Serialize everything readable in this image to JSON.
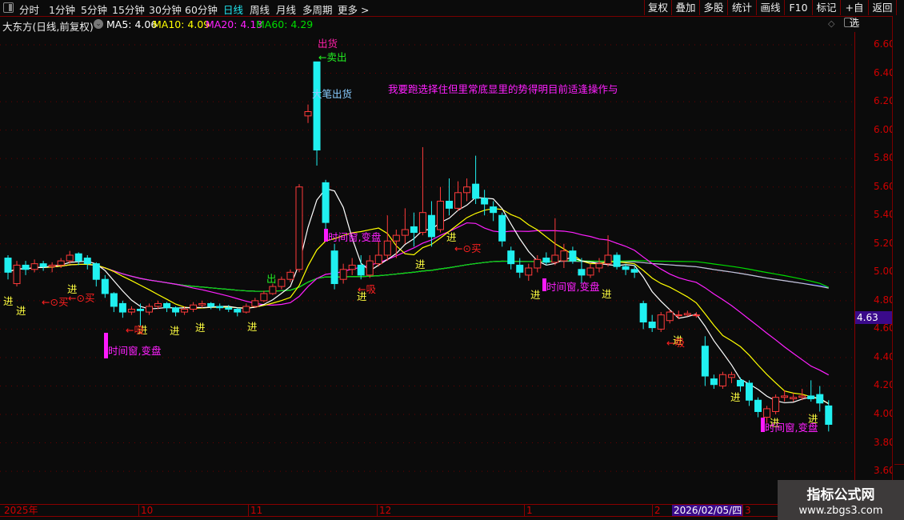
{
  "toolbar": {
    "periods": [
      "分时",
      "1分钟",
      "5分钟",
      "15分钟",
      "30分钟",
      "60分钟",
      "日线",
      "周线",
      "月线",
      "多周期",
      "更多 >"
    ],
    "active_period": "日线",
    "buttons": [
      "复权",
      "叠加",
      "多股",
      "统计",
      "画线",
      "F10",
      "标记",
      "+自选",
      "返回"
    ]
  },
  "title": {
    "stock": "大东方(日线,前复权)",
    "ma5": "MA5: 4.06",
    "ma10": "MA10: 4.09",
    "ma20": "MA20: 4.13",
    "ma60": "MA60: 4.29"
  },
  "colors": {
    "up": "#ff3b3b",
    "down": "#20f0f0",
    "ma5": "#ffffff",
    "ma10": "#ffff00",
    "ma20": "#ff20ff",
    "ma60": "#00dd00",
    "line5": "#c8c8c8",
    "line6": "#2020ff",
    "axis": "#d00000",
    "buy": "#ff2020",
    "enter": "#ffff40",
    "window": "#ff20ff"
  },
  "y_axis": {
    "ticks": [
      "6.60",
      "6.40",
      "6.20",
      "6.00",
      "5.80",
      "5.60",
      "5.40",
      "5.20",
      "5.00",
      "4.80",
      "4.60",
      "4.40",
      "4.20",
      "4.00",
      "3.80",
      "3.60"
    ],
    "current_price": "4.63"
  },
  "x_axis": {
    "labels": [
      "2025年",
      "10",
      "11",
      "12",
      "1",
      "2",
      "3"
    ],
    "selected_date": "2026/02/05/四"
  },
  "annotations": {
    "sell_top": "出货",
    "sell_arrow": "←卖出",
    "big_sell": "大笔出货",
    "message": "我要跑选择住但里常底显里的势得明目前适逢操作与",
    "enter": "进",
    "buy": "←⊙买",
    "absorb": "←吸",
    "out": "出",
    "window": "时间窗,变盘"
  },
  "watermark": {
    "title": "指标公式网",
    "url": "www.zbgs3.com"
  },
  "chart_data": {
    "type": "candlestick",
    "ylim": [
      3.5,
      6.7
    ],
    "ohlc": [
      [
        5.1,
        5.12,
        4.95,
        5.0
      ],
      [
        4.92,
        5.08,
        4.9,
        5.05
      ],
      [
        5.05,
        5.08,
        4.98,
        5.02
      ],
      [
        5.02,
        5.09,
        5.0,
        5.06
      ],
      [
        5.06,
        5.08,
        5.01,
        5.04
      ],
      [
        5.04,
        5.07,
        5.0,
        5.05
      ],
      [
        5.05,
        5.1,
        5.03,
        5.08
      ],
      [
        5.08,
        5.15,
        5.06,
        5.12
      ],
      [
        5.13,
        5.14,
        5.05,
        5.08
      ],
      [
        5.1,
        5.12,
        5.02,
        5.06
      ],
      [
        5.06,
        5.07,
        4.9,
        4.95
      ],
      [
        4.95,
        4.98,
        4.82,
        4.85
      ],
      [
        4.85,
        4.86,
        4.72,
        4.76
      ],
      [
        4.78,
        4.8,
        4.68,
        4.72
      ],
      [
        4.72,
        4.76,
        4.7,
        4.74
      ],
      [
        4.74,
        4.78,
        4.62,
        4.73
      ],
      [
        4.72,
        4.78,
        4.7,
        4.76
      ],
      [
        4.76,
        4.8,
        4.74,
        4.78
      ],
      [
        4.78,
        4.79,
        4.72,
        4.75
      ],
      [
        4.75,
        4.76,
        4.69,
        4.72
      ],
      [
        4.72,
        4.76,
        4.7,
        4.74
      ],
      [
        4.74,
        4.79,
        4.72,
        4.77
      ],
      [
        4.77,
        4.8,
        4.75,
        4.78
      ],
      [
        4.78,
        4.79,
        4.74,
        4.76
      ],
      [
        4.76,
        4.78,
        4.73,
        4.75
      ],
      [
        4.75,
        4.77,
        4.72,
        4.74
      ],
      [
        4.74,
        4.75,
        4.69,
        4.72
      ],
      [
        4.72,
        4.78,
        4.71,
        4.76
      ],
      [
        4.76,
        4.82,
        4.75,
        4.8
      ],
      [
        4.8,
        4.87,
        4.79,
        4.85
      ],
      [
        4.85,
        4.92,
        4.84,
        4.9
      ],
      [
        4.9,
        4.97,
        4.88,
        4.95
      ],
      [
        4.95,
        5.02,
        4.93,
        5.0
      ],
      [
        5.02,
        5.62,
        5.0,
        5.6
      ],
      [
        6.1,
        6.18,
        6.05,
        6.13
      ],
      [
        6.48,
        6.48,
        5.75,
        5.86
      ],
      [
        5.63,
        5.65,
        5.3,
        5.35
      ],
      [
        5.15,
        5.2,
        4.88,
        4.92
      ],
      [
        4.95,
        5.06,
        4.92,
        5.02
      ],
      [
        5.02,
        5.1,
        4.98,
        5.05
      ],
      [
        5.05,
        5.12,
        4.95,
        4.98
      ],
      [
        4.98,
        5.12,
        4.96,
        5.08
      ],
      [
        5.06,
        5.22,
        5.04,
        5.12
      ],
      [
        5.12,
        5.4,
        5.08,
        5.22
      ],
      [
        5.22,
        5.3,
        5.1,
        5.26
      ],
      [
        5.26,
        5.45,
        5.2,
        5.3
      ],
      [
        5.32,
        5.42,
        5.18,
        5.28
      ],
      [
        5.28,
        5.88,
        5.26,
        5.42
      ],
      [
        5.4,
        5.5,
        5.18,
        5.25
      ],
      [
        5.3,
        5.6,
        5.28,
        5.5
      ],
      [
        5.5,
        5.66,
        5.4,
        5.45
      ],
      [
        5.45,
        5.64,
        5.43,
        5.56
      ],
      [
        5.56,
        5.66,
        5.5,
        5.6
      ],
      [
        5.62,
        5.82,
        5.48,
        5.52
      ],
      [
        5.52,
        5.58,
        5.4,
        5.48
      ],
      [
        5.46,
        5.5,
        5.36,
        5.42
      ],
      [
        5.4,
        5.42,
        5.18,
        5.22
      ],
      [
        5.15,
        5.18,
        5.02,
        5.06
      ],
      [
        5.05,
        5.1,
        4.96,
        5.0
      ],
      [
        4.98,
        5.06,
        4.94,
        5.03
      ],
      [
        5.03,
        5.12,
        5.0,
        5.09
      ],
      [
        5.1,
        5.14,
        5.05,
        5.07
      ],
      [
        5.07,
        5.38,
        5.05,
        5.12
      ],
      [
        5.08,
        5.2,
        5.03,
        5.15
      ],
      [
        5.15,
        5.18,
        5.06,
        5.08
      ],
      [
        5.02,
        5.1,
        4.92,
        4.98
      ],
      [
        4.98,
        5.06,
        4.96,
        5.03
      ],
      [
        5.03,
        5.1,
        5.0,
        5.06
      ],
      [
        5.06,
        5.26,
        5.04,
        5.12
      ],
      [
        5.12,
        5.14,
        5.02,
        5.04
      ],
      [
        5.04,
        5.06,
        4.98,
        5.02
      ],
      [
        5.02,
        5.05,
        4.96,
        5.0
      ],
      [
        4.78,
        4.8,
        4.6,
        4.65
      ],
      [
        4.65,
        4.7,
        4.58,
        4.61
      ],
      [
        4.6,
        4.72,
        4.58,
        4.7
      ],
      [
        4.66,
        4.74,
        4.64,
        4.72
      ],
      [
        4.7,
        4.73,
        4.67,
        4.7
      ],
      [
        4.7,
        4.73,
        4.69,
        4.71
      ],
      [
        4.7,
        4.72,
        4.68,
        4.7
      ],
      [
        4.48,
        4.55,
        4.2,
        4.27
      ],
      [
        4.25,
        4.28,
        4.18,
        4.21
      ],
      [
        4.2,
        4.3,
        4.18,
        4.28
      ],
      [
        4.26,
        4.3,
        4.22,
        4.28
      ],
      [
        4.24,
        4.26,
        4.16,
        4.2
      ],
      [
        4.22,
        4.24,
        4.06,
        4.1
      ],
      [
        4.1,
        4.12,
        3.98,
        4.02
      ],
      [
        3.98,
        4.06,
        3.94,
        4.04
      ],
      [
        4.02,
        4.14,
        4.0,
        4.12
      ],
      [
        4.12,
        4.17,
        4.09,
        4.13
      ],
      [
        4.11,
        4.15,
        4.09,
        4.12
      ],
      [
        4.12,
        4.18,
        4.1,
        4.13
      ],
      [
        4.13,
        4.24,
        4.09,
        4.11
      ],
      [
        4.14,
        4.2,
        4.02,
        4.08
      ],
      [
        4.06,
        4.1,
        3.88,
        3.93
      ]
    ]
  }
}
